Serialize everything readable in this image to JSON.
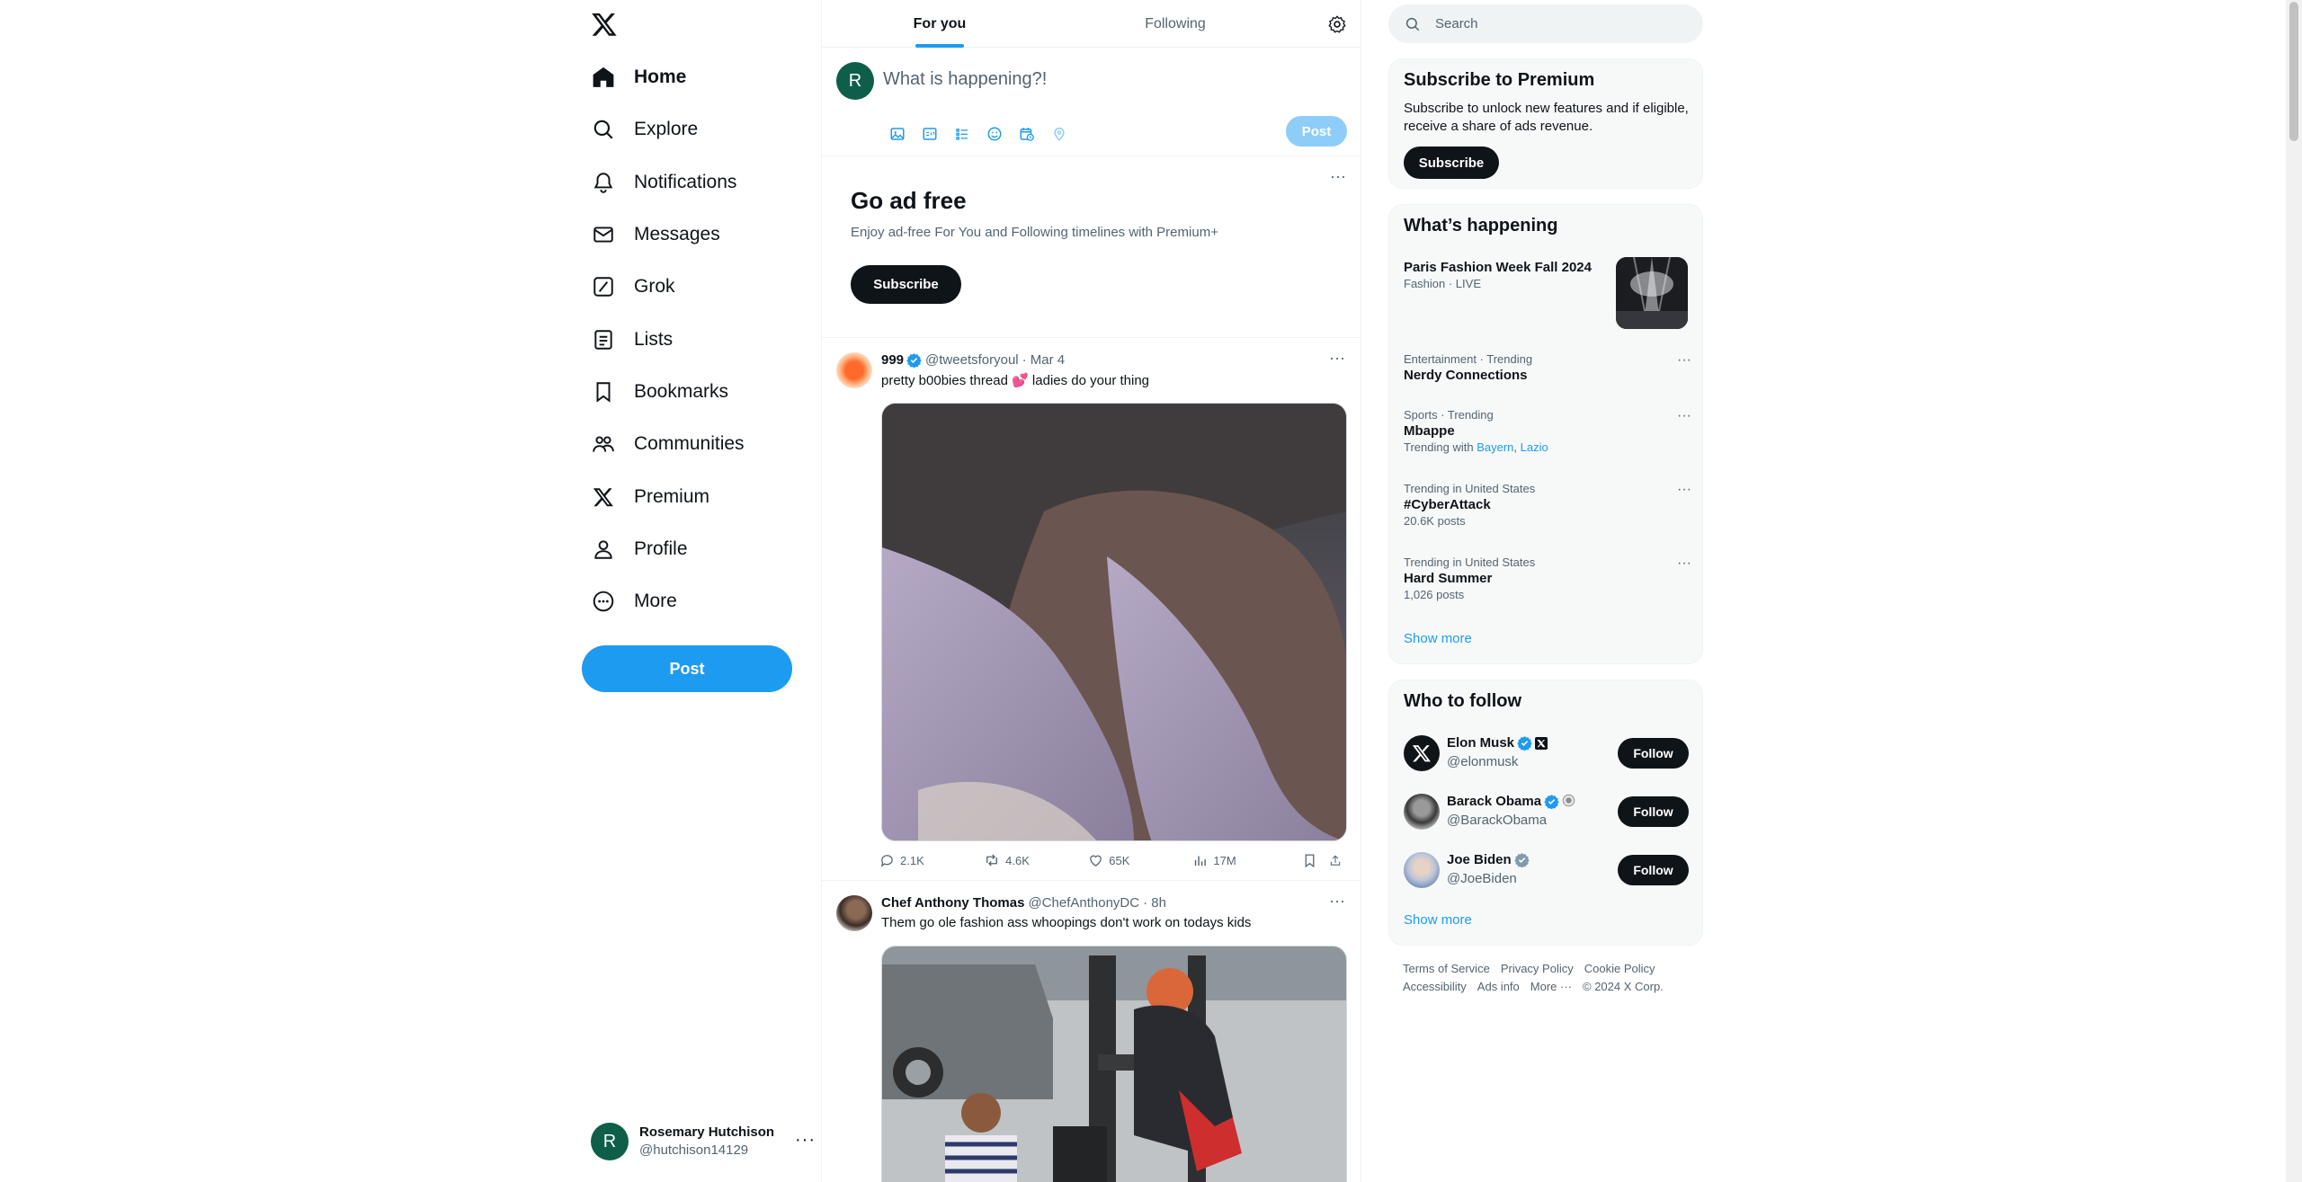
{
  "nav": {
    "items": [
      {
        "label": "Home",
        "icon": "home-icon"
      },
      {
        "label": "Explore",
        "icon": "search-icon"
      },
      {
        "label": "Notifications",
        "icon": "bell-icon"
      },
      {
        "label": "Messages",
        "icon": "envelope-icon"
      },
      {
        "label": "Grok",
        "icon": "grok-icon"
      },
      {
        "label": "Lists",
        "icon": "list-icon"
      },
      {
        "label": "Bookmarks",
        "icon": "bookmark-icon"
      },
      {
        "label": "Communities",
        "icon": "communities-icon"
      },
      {
        "label": "Premium",
        "icon": "x-logo-icon"
      },
      {
        "label": "Profile",
        "icon": "person-icon"
      },
      {
        "label": "More",
        "icon": "more-circle-icon"
      }
    ],
    "post_label": "Post"
  },
  "account": {
    "initial": "R",
    "name": "Rosemary Hutchison",
    "handle": "@hutchison14129",
    "more": "···"
  },
  "tabs": {
    "for_you": "For you",
    "following": "Following"
  },
  "composer": {
    "initial": "R",
    "placeholder": "What is happening?!",
    "post_label": "Post"
  },
  "adfree": {
    "title": "Go ad free",
    "subtitle": "Enjoy ad-free For You and Following timelines with Premium+",
    "button": "Subscribe",
    "more": "···"
  },
  "tweets": [
    {
      "name": "999",
      "handle": "@tweetsforyoul",
      "time": "· Mar 4",
      "text": "pretty b00bies thread 💕 ladies do your thing",
      "replies": "2.1K",
      "reposts": "4.6K",
      "likes": "65K",
      "views": "17M"
    },
    {
      "name": "Chef Anthony Thomas",
      "handle": "@ChefAnthonyDC",
      "time": "· 8h",
      "text": "Them go ole fashion ass whoopings don't work on todays kids"
    }
  ],
  "search": {
    "placeholder": "Search"
  },
  "premium": {
    "title": "Subscribe to Premium",
    "description": "Subscribe to unlock new features and if eligible, receive a share of ads revenue.",
    "button": "Subscribe"
  },
  "happening": {
    "title": "What’s happening",
    "items": [
      {
        "name": "Paris Fashion Week Fall 2024",
        "category": "Fashion · LIVE"
      },
      {
        "category": "Entertainment · Trending",
        "name": "Nerdy Connections"
      },
      {
        "category": "Sports · Trending",
        "name": "Mbappe",
        "with_prefix": "Trending with",
        "with": [
          "Bayern",
          "Lazio"
        ]
      },
      {
        "category": "Trending in United States",
        "name": "#CyberAttack",
        "count": "20.6K posts"
      },
      {
        "category": "Trending in United States",
        "name": "Hard Summer",
        "count": "1,026 posts"
      }
    ],
    "show_more": "Show more"
  },
  "who_to_follow": {
    "title": "Who to follow",
    "people": [
      {
        "name": "Elon Musk",
        "handle": "@elonmusk",
        "button": "Follow"
      },
      {
        "name": "Barack Obama",
        "handle": "@BarackObama",
        "button": "Follow"
      },
      {
        "name": "Joe Biden",
        "handle": "@JoeBiden",
        "button": "Follow"
      }
    ],
    "show_more": "Show more"
  },
  "footer": {
    "links": [
      "Terms of Service",
      "Privacy Policy",
      "Cookie Policy",
      "Accessibility",
      "Ads info",
      "More ···",
      "© 2024 X Corp."
    ]
  },
  "colors": {
    "accent": "#1d9bf0",
    "text": "#0f1419",
    "muted": "#536471"
  }
}
